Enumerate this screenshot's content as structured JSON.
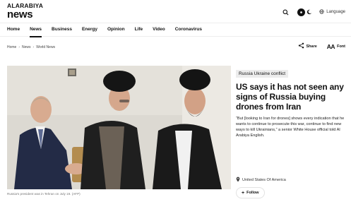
{
  "logo": {
    "top": "ALARABIYA",
    "bottom": "news"
  },
  "header": {
    "language_label": "Language"
  },
  "nav": {
    "items": [
      {
        "label": "Home"
      },
      {
        "label": "News"
      },
      {
        "label": "Business"
      },
      {
        "label": "Energy"
      },
      {
        "label": "Opinion"
      },
      {
        "label": "Life"
      },
      {
        "label": "Video"
      },
      {
        "label": "Coronavirus"
      }
    ],
    "active": "News"
  },
  "breadcrumb": {
    "items": [
      "Home",
      "News",
      "World News"
    ]
  },
  "tools": {
    "share_label": "Share",
    "font_label": "Font",
    "font_glyph": "AA"
  },
  "article": {
    "tag": "Russia Ukraine conflict",
    "headline": "US says it has not seen any signs of Russia buying drones from Iran",
    "summary": "“But [looking to Iran for drones] shows every indication that he wants to continue to prosecute this war, continue to find new ways to kill Ukrainians,” a senior White House official told Al Arabiya English.",
    "location": "United States Of America",
    "follow_label": "Follow",
    "image_caption": "Russia's president was in Tehran on July 19. (AFP)"
  },
  "icons": {
    "search": "search-icon",
    "theme": "moon-icon",
    "language": "globe-icon",
    "share": "share-icon",
    "location": "location-pin-icon",
    "follow": "plus-icon"
  },
  "colors": {
    "text": "#111111",
    "tag_bg": "#ececec",
    "muted": "#777777"
  }
}
